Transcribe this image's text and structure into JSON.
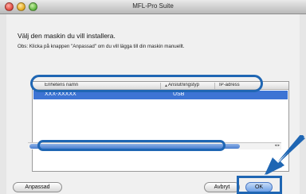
{
  "window": {
    "title": "MFL-Pro Suite"
  },
  "dialog": {
    "heading": "Välj den maskin du vill installera.",
    "note": "Obs: Klicka på knappen \"Anpassad\" om du vill lägga till din maskin manuellt."
  },
  "list": {
    "columns": [
      "Enhetens namn",
      "Anslutningstyp",
      "IP-adress"
    ],
    "rows": [
      {
        "name": "XXX-XXXXX",
        "connection": "USB",
        "selected": true
      }
    ]
  },
  "buttons": {
    "anpassad": "Anpassad",
    "avbryt": "Avbryt",
    "ok": "OK"
  },
  "colors": {
    "selection": "#3d74d4",
    "annotation": "#1f66b3"
  }
}
